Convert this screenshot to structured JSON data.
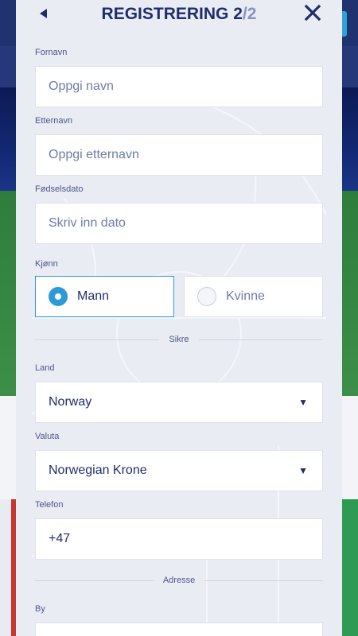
{
  "header": {
    "title": "REGISTRERING",
    "step": "2",
    "separator": "/",
    "total": "2"
  },
  "fields": {
    "first_name": {
      "label": "Fornavn",
      "placeholder": "Oppgi navn"
    },
    "last_name": {
      "label": "Etternavn",
      "placeholder": "Oppgi etternavn"
    },
    "birthdate": {
      "label": "Fødselsdato",
      "placeholder": "Skriv inn dato"
    },
    "gender": {
      "label": "Kjønn",
      "options": [
        "Mann",
        "Kvinne"
      ],
      "selected": "Mann"
    },
    "country": {
      "label": "Land",
      "value": "Norway"
    },
    "currency": {
      "label": "Valuta",
      "value": "Norwegian Krone"
    },
    "phone": {
      "label": "Telefon",
      "value": "+47"
    },
    "city": {
      "label": "By"
    }
  },
  "sections": {
    "secure": "Sikre",
    "address": "Adresse"
  },
  "colors": {
    "accent": "#2d9ad7",
    "title": "#1f2e6b",
    "modal_bg": "#eaecf4"
  },
  "icons": [
    "back-arrow-icon",
    "close-icon",
    "chevron-down-icon"
  ]
}
